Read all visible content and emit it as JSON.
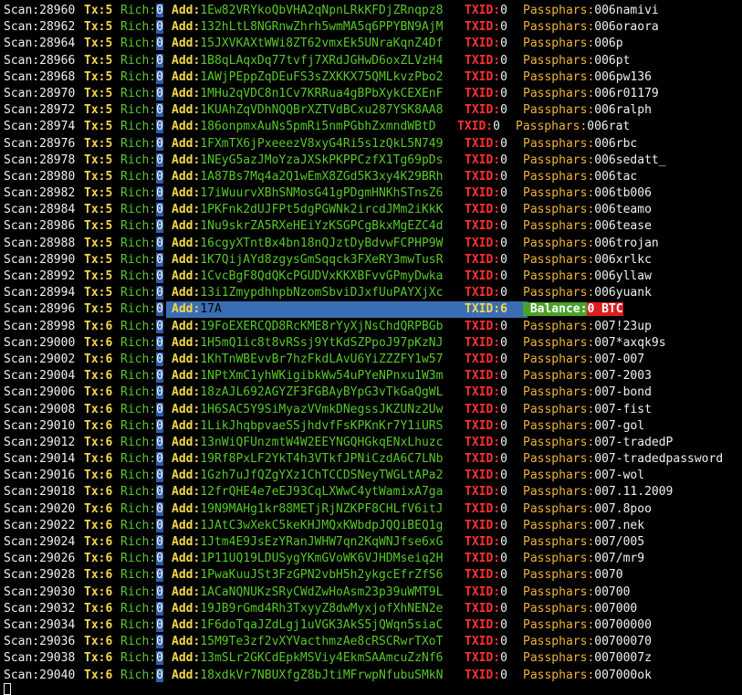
{
  "labels": {
    "scan": "Scan:",
    "tx": "Tx:",
    "rich": "Rich:",
    "add": "Add:",
    "txid": "TXID:",
    "passphrase": "Passphars:",
    "balance": "Balance:"
  },
  "colors": {
    "background": "#000000",
    "scan": "#f0f0f0",
    "label_yellow": "#f2d84a",
    "address_green": "#58c82a",
    "txid_red": "#ff3030",
    "passphrase_orange": "#f0b437",
    "highlight_blue": "#3b6db5",
    "balance_green": "#48a32a",
    "balance_red": "#d91e1e"
  },
  "rows": [
    {
      "scan": "28960",
      "tx": "5",
      "rich": "0",
      "addr": "1Ew82VRYkoQbVHA2qNpnLRkKFDjZRnqpz8",
      "txid": "0",
      "pass": "006namivi"
    },
    {
      "scan": "28962",
      "tx": "5",
      "rich": "0",
      "addr": "132hLtL8NGRnwZhrh5wmMA5q6PPYBN9AjM",
      "txid": "0",
      "pass": "006oraora"
    },
    {
      "scan": "28964",
      "tx": "5",
      "rich": "0",
      "addr": "15JXVKAXtWWi8ZT62vmxEk5UNraKqnZ4Df",
      "txid": "0",
      "pass": "006p"
    },
    {
      "scan": "28966",
      "tx": "5",
      "rich": "0",
      "addr": "1B8qLAqxDq77tvfj7XRdJGHwD6oxZLVzH4",
      "txid": "0",
      "pass": "006pt"
    },
    {
      "scan": "28968",
      "tx": "5",
      "rich": "0",
      "addr": "1AWjPEppZqDEuFS3sZXKKX75QMLkvzPbo2",
      "txid": "0",
      "pass": "006pw136"
    },
    {
      "scan": "28970",
      "tx": "5",
      "rich": "0",
      "addr": "1MHu2qVDC8n1Cv7KRRua4gBPbXykCEXEnF",
      "txid": "0",
      "pass": "006r01179"
    },
    {
      "scan": "28972",
      "tx": "5",
      "rich": "0",
      "addr": "1KUAhZqVDhNQQBrXZTVdBCxu287YSK8AA8",
      "txid": "0",
      "pass": "006ralph"
    },
    {
      "scan": "28974",
      "tx": "5",
      "rich": "0",
      "addr": "186onpmxAuNs5pmRi5nmPGbhZxmndWBtD",
      "txid": "0",
      "pass": "006rat",
      "shift": true
    },
    {
      "scan": "28976",
      "tx": "5",
      "rich": "0",
      "addr": "1FXmTX6jPxeeezV8xyG4Ri5s1zQkL5N749",
      "txid": "0",
      "pass": "006rbc"
    },
    {
      "scan": "28978",
      "tx": "5",
      "rich": "0",
      "addr": "1NEyG5azJMoYzaJXSkPKPPCzfX1Tg69pDs",
      "txid": "0",
      "pass": "006sedatt_"
    },
    {
      "scan": "28980",
      "tx": "5",
      "rich": "0",
      "addr": "1A87Bs7Mq4a2Q1wEmX8ZGd5K3xy4K29BRh",
      "txid": "0",
      "pass": "006tac"
    },
    {
      "scan": "28982",
      "tx": "5",
      "rich": "0",
      "addr": "17iWuurvXBhSNMosG41gPDgmHNKhSTnsZ6",
      "txid": "0",
      "pass": "006tb006"
    },
    {
      "scan": "28984",
      "tx": "5",
      "rich": "0",
      "addr": "1PKFnk2dUJFPt5dgPGWNk2ircdJMm2iKkK",
      "txid": "0",
      "pass": "006teamo"
    },
    {
      "scan": "28986",
      "tx": "5",
      "rich": "0",
      "addr": "1Nu9skrZA5RXeHEiYzKSGPCgBkxMgEZC4d",
      "txid": "0",
      "pass": "006tease"
    },
    {
      "scan": "28988",
      "tx": "5",
      "rich": "0",
      "addr": "16cgyXTntBx4bn18nQJztDyBdvwFCPHP9W",
      "txid": "0",
      "pass": "006trojan"
    },
    {
      "scan": "28990",
      "tx": "5",
      "rich": "0",
      "addr": "1K7QijAYd8zgysGmSqqck3FXeRY3mwTusR",
      "txid": "0",
      "pass": "006xrlkc"
    },
    {
      "scan": "28992",
      "tx": "5",
      "rich": "0",
      "addr": "1CvcBgF8QdQKcPGUDVxKKXBFvvGPmyDwka",
      "txid": "0",
      "pass": "006yllaw"
    },
    {
      "scan": "28994",
      "tx": "5",
      "rich": "0",
      "addr": "13i1ZmypdhhpbNzomSbviDJxfUuPAYXjXc",
      "txid": "0",
      "pass": "006yuank"
    },
    {
      "scan": "28996",
      "tx": "5",
      "rich": "0",
      "addr": "17A",
      "txid": "6",
      "pass": "",
      "highlight": true,
      "balance": "0 BTC"
    },
    {
      "scan": "28998",
      "tx": "6",
      "rich": "0",
      "addr": "19FoEXERCQD8RcKME8rYyXjNsChdQRPBGb",
      "txid": "0",
      "pass": "007!23up"
    },
    {
      "scan": "29000",
      "tx": "6",
      "rich": "0",
      "addr": "1H5mQ1ic8t8vRSsj9YtKdSZPpoJ97pKzNJ",
      "txid": "0",
      "pass": "007*axqk9s"
    },
    {
      "scan": "29002",
      "tx": "6",
      "rich": "0",
      "addr": "1KhTnWBEvvBr7hzFkdLAvU6YiZZZFY1w57",
      "txid": "0",
      "pass": "007-007"
    },
    {
      "scan": "29004",
      "tx": "6",
      "rich": "0",
      "addr": "1NPtXmC1yhWKigibkWw54uPYeNPnxu1W3m",
      "txid": "0",
      "pass": "007-2003"
    },
    {
      "scan": "29006",
      "tx": "6",
      "rich": "0",
      "addr": "18zAJL692AGYZF3FGBAyBYpG3vTkGaQgWL",
      "txid": "0",
      "pass": "007-bond"
    },
    {
      "scan": "29008",
      "tx": "6",
      "rich": "0",
      "addr": "1H6SAC5Y9SiMyazVVmkDNegssJKZUNz2Uw",
      "txid": "0",
      "pass": "007-fist"
    },
    {
      "scan": "29010",
      "tx": "6",
      "rich": "0",
      "addr": "1LikJhqbpvaeSSjhdvfFsKPKnKr7Y1iURS",
      "txid": "0",
      "pass": "007-gol"
    },
    {
      "scan": "29012",
      "tx": "6",
      "rich": "0",
      "addr": "13nWiQFUnzmtW4W2EEYNGQHGkqENxLhuzc",
      "txid": "0",
      "pass": "007-tradedP"
    },
    {
      "scan": "29014",
      "tx": "6",
      "rich": "0",
      "addr": "19Rf8PxLF2YkT4h3VTkfJPNiCzdA6C7LNb",
      "txid": "0",
      "pass": "007-tradedpassword"
    },
    {
      "scan": "29016",
      "tx": "6",
      "rich": "0",
      "addr": "1Gzh7uJfQZgYXz1ChTCCDSNeyTWGLtAPa2",
      "txid": "0",
      "pass": "007-wol"
    },
    {
      "scan": "29018",
      "tx": "6",
      "rich": "0",
      "addr": "12frQHE4e7eEJ93CqLXWwC4ytWamixA7ga",
      "txid": "0",
      "pass": "007.11.2009"
    },
    {
      "scan": "29020",
      "tx": "6",
      "rich": "0",
      "addr": "19N9MAHg1kr88METjRjNZKPF8CHLfV6itJ",
      "txid": "0",
      "pass": "007.8poo"
    },
    {
      "scan": "29022",
      "tx": "6",
      "rich": "0",
      "addr": "1JAtC3wXekC5keKHJMQxKWbdpJQQiBEQ1g",
      "txid": "0",
      "pass": "007.nek"
    },
    {
      "scan": "29024",
      "tx": "6",
      "rich": "0",
      "addr": "1Jtm4E9JsEzYRanJWHW7qn2KqWNJfse6xG",
      "txid": "0",
      "pass": "007/005"
    },
    {
      "scan": "29026",
      "tx": "6",
      "rich": "0",
      "addr": "1P11UQ19LDUSygYKmGVoWK6VJHDMseiq2H",
      "txid": "0",
      "pass": "007/mr9"
    },
    {
      "scan": "29028",
      "tx": "6",
      "rich": "0",
      "addr": "1PwaKuuJSt3FzGPN2vbH5h2ykgcEfrZfS6",
      "txid": "0",
      "pass": "0070"
    },
    {
      "scan": "29030",
      "tx": "6",
      "rich": "0",
      "addr": "1ACaNQNUKzSRyCWdZwHoAsm23p39uWMT9L",
      "txid": "0",
      "pass": "00700"
    },
    {
      "scan": "29032",
      "tx": "6",
      "rich": "0",
      "addr": "19JB9rGmd4Rh3TxyyZ8dwMyxjofXhNEN2e",
      "txid": "0",
      "pass": "007000"
    },
    {
      "scan": "29034",
      "tx": "6",
      "rich": "0",
      "addr": "1F6doTqaJZdLgj1uVGK3AkS5jQWqn5siaC",
      "txid": "0",
      "pass": "00700000"
    },
    {
      "scan": "29036",
      "tx": "6",
      "rich": "0",
      "addr": "15M9Te3zf2vXYVacthmzAe8cRSCRwrTXoT",
      "txid": "0",
      "pass": "00700070"
    },
    {
      "scan": "29038",
      "tx": "6",
      "rich": "0",
      "addr": "13mSLr2GKCdEpkMSViy4EkmSAAmcuZzNf6",
      "txid": "0",
      "pass": "0070007z"
    },
    {
      "scan": "29040",
      "tx": "6",
      "rich": "0",
      "addr": "18xdkVr7NBUXfgZ8bJtiMFrwpNfubuSMkN",
      "txid": "0",
      "pass": "007000ok"
    }
  ]
}
